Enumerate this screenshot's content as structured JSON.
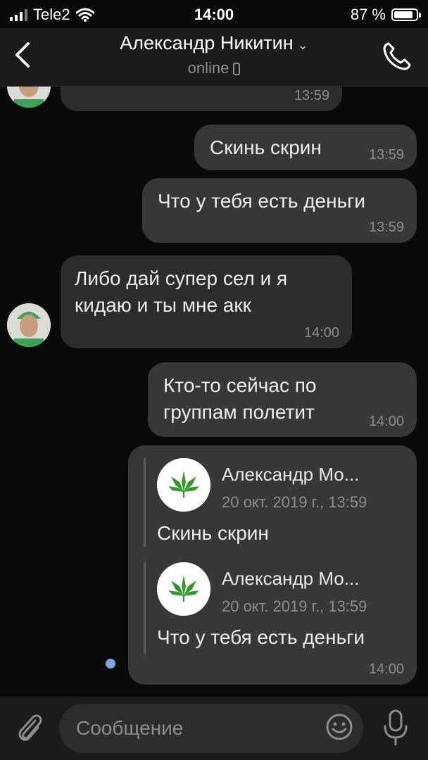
{
  "status_bar": {
    "carrier": "Tele2",
    "time": "14:00",
    "battery": "87 %",
    "battery_level": 0.87
  },
  "header": {
    "contact_name": "Александр Никитин",
    "status": "online"
  },
  "messages": [
    {
      "direction": "in",
      "text": "",
      "time": "13:59"
    },
    {
      "direction": "out",
      "text": "Скинь скрин",
      "time": "13:59"
    },
    {
      "direction": "out",
      "text": "Что у тебя есть деньги",
      "time": "13:59"
    },
    {
      "direction": "in",
      "lines": [
        "Либо дай супер сел  и я",
        "кидаю и ты мне акк"
      ],
      "time": "14:00"
    },
    {
      "direction": "out",
      "lines": [
        "Кто-то сейчас по",
        "группам полетит"
      ],
      "time": "14:00"
    },
    {
      "direction": "out",
      "time": "14:00",
      "forwarded": [
        {
          "author": "Александр Мо...",
          "date": "20 окт. 2019 г., 13:59",
          "text": "Скинь скрин"
        },
        {
          "author": "Александр Мо...",
          "date": "20 окт. 2019 г., 13:59",
          "text": "Что у тебя есть деньги"
        }
      ]
    }
  ],
  "composer": {
    "placeholder": "Сообщение"
  },
  "icons": {
    "back": "chevron-left-icon",
    "call": "phone-icon",
    "attach": "paperclip-icon",
    "emoji": "smiley-icon",
    "mic": "microphone-icon",
    "wifi": "wifi-icon",
    "battery": "battery-icon"
  },
  "colors": {
    "background": "#0a0a0a",
    "bubble_in": "#2c2c2e",
    "bubble_out": "#373739",
    "unread_dot": "#7ea6de"
  }
}
